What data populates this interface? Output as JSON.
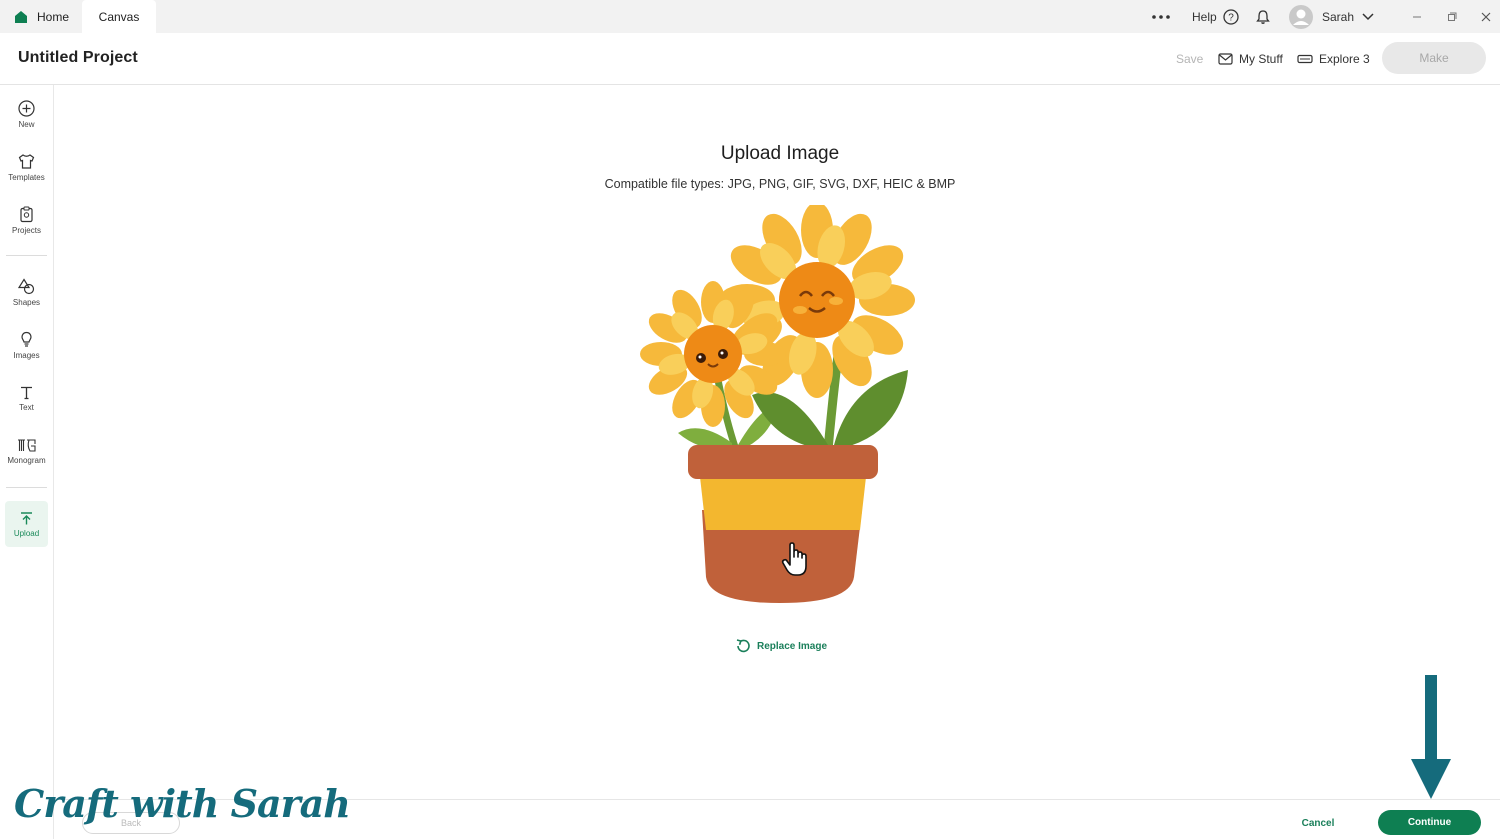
{
  "titlebar": {
    "tabs": [
      {
        "label": "Home"
      },
      {
        "label": "Canvas"
      }
    ],
    "help_label": "Help",
    "user_name": "Sarah"
  },
  "header": {
    "project_title": "Untitled Project",
    "save_label": "Save",
    "my_stuff_label": "My Stuff",
    "machine_label": "Explore 3",
    "make_label": "Make"
  },
  "sidebar": {
    "items": [
      {
        "label": "New",
        "icon": "plus-circle-icon"
      },
      {
        "label": "Templates",
        "icon": "shirt-icon"
      },
      {
        "label": "Projects",
        "icon": "clipboard-icon"
      },
      {
        "label": "Shapes",
        "icon": "shapes-icon"
      },
      {
        "label": "Images",
        "icon": "lightbulb-icon"
      },
      {
        "label": "Text",
        "icon": "text-icon"
      },
      {
        "label": "Monogram",
        "icon": "monogram-icon"
      },
      {
        "label": "Upload",
        "icon": "upload-icon"
      }
    ]
  },
  "main": {
    "title": "Upload Image",
    "subtitle": "Compatible file types:  JPG, PNG, GIF, SVG, DXF, HEIC & BMP",
    "replace_label": "Replace Image"
  },
  "footer": {
    "back_label": "Back",
    "cancel_label": "Cancel",
    "continue_label": "Continue"
  },
  "watermark": "Craft with Sarah",
  "colors": {
    "accent": "#0e7f52",
    "watermark": "#156b7c",
    "arrow": "#156b7c"
  }
}
